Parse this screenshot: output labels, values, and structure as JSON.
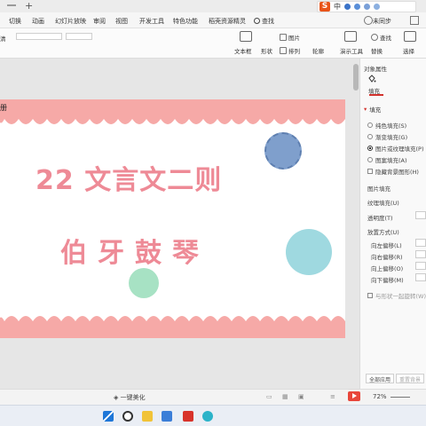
{
  "titlebar": {
    "new_tab": "+"
  },
  "ime": {
    "logo": "S",
    "lang": "中"
  },
  "menu": {
    "items": [
      "切换",
      "动画",
      "幻灯片放映",
      "审阅",
      "视图",
      "开发工具",
      "特色功能",
      "稻壳资源精灵"
    ],
    "search_label": "查找",
    "right_label": "未同步"
  },
  "ribbon": {
    "left_tail": "清",
    "picture": "图片",
    "text_box": "文本框",
    "shape": "形状",
    "arrange": "排列",
    "outline": "轮廓",
    "slideshow": "演示工具",
    "replace": "替换",
    "find": "查找",
    "select": "选择"
  },
  "slide": {
    "top_tag": "册",
    "title": "22 文言文二则",
    "subtitle": "伯牙鼓琴",
    "colors": {
      "band": "#f6a9a7",
      "title": "#ee8a96",
      "blue": "#7f9fcc",
      "cyan": "#9fd9e0",
      "green": "#a7e2c4"
    }
  },
  "panel": {
    "header": "对象属性",
    "tab": "填充",
    "section": "填充",
    "fill_options": [
      "纯色填充(S)",
      "渐变填充(G)",
      "图片或纹理填充(P)",
      "图案填充(A)"
    ],
    "selected_index": 2,
    "hide_bg": "隐藏背景图形(H)",
    "picture_fill": "图片填充",
    "texture_fill": "纹理填充(U)",
    "transparency": "透明度(T)",
    "placement": "放置方式(U)",
    "offsets": [
      "向左偏移(L)",
      "向右偏移(R)",
      "向上偏移(O)",
      "向下偏移(M)"
    ],
    "rotate": "与形状一起旋转(W)",
    "apply_all": "全部应用",
    "reset": "重置背景"
  },
  "statusbar": {
    "beautify": "一键美化",
    "zoom": "72%"
  }
}
